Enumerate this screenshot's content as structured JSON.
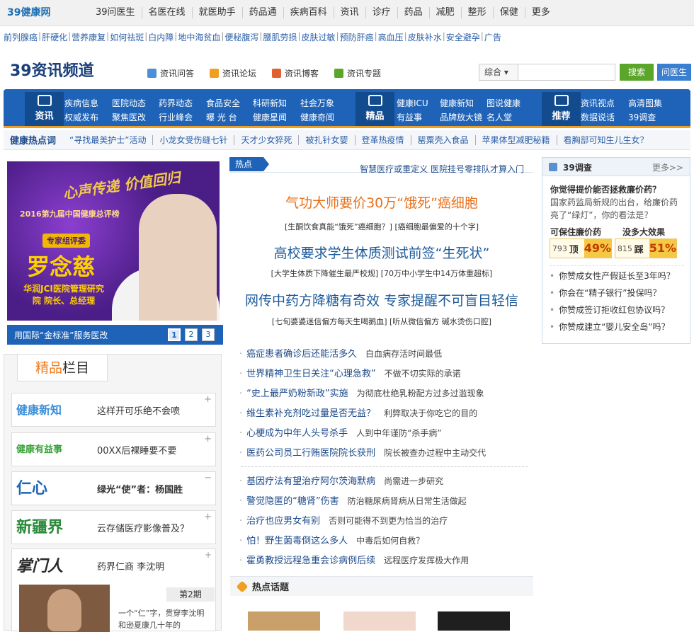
{
  "top": {
    "logo": "39健康网",
    "nav": [
      "39问医生",
      "名医在线",
      "就医助手",
      "药品通",
      "疾病百科",
      "资讯",
      "诊疗",
      "药品",
      "减肥",
      "整形",
      "保健",
      "更多"
    ]
  },
  "quick_links": [
    "前列腺癌",
    "肝硬化",
    "营养康复",
    "如何祛斑",
    "白内障",
    "地中海贫血",
    "便秘腹泻",
    "腰肌劳损",
    "皮肤过敏",
    "预防肝癌",
    "高血压",
    "皮肤补水",
    "安全避孕",
    "广告"
  ],
  "channel": {
    "logo": "39资讯频道",
    "links": [
      "资讯问答",
      "资讯论坛",
      "资讯博客",
      "资讯专题"
    ],
    "search_select": "综合",
    "search_btn": "搜索",
    "ask_btn": "问医生"
  },
  "bluenav": {
    "groups": [
      {
        "icon_label": "资讯",
        "cols": [
          [
            "疾病信息",
            "权威发布"
          ],
          [
            "医院动态",
            "聚焦医改"
          ],
          [
            "药界动态",
            "行业峰会"
          ],
          [
            "食品安全",
            "曝 光 台"
          ],
          [
            "科研新知",
            "健康星闻"
          ],
          [
            "社会万象",
            "健康奇闻"
          ]
        ]
      },
      {
        "icon_label": "精品",
        "cols": [
          [
            "健康ICU",
            "有益事"
          ],
          [
            "健康新知",
            "品牌放大镜"
          ],
          [
            "图说健康",
            "名人堂"
          ]
        ]
      },
      {
        "icon_label": "推荐",
        "cols": [
          [
            "资讯视点",
            "数据说话"
          ],
          [
            "高清图集",
            "39调查"
          ]
        ]
      }
    ]
  },
  "hotbar": {
    "title": "健康热点词",
    "items": [
      "“寻找最美护士”活动",
      "小龙女受伤缝七针",
      "天才少女猝死",
      "被扎针女婴",
      "登革热疫情",
      "罂粟壳入食品",
      "苹果体型减肥秘籍",
      "看胸部可知生儿生女？"
    ]
  },
  "banner": {
    "slogan": "心声传递 价值回归",
    "award": "2016第九届中国健康总评榜",
    "tag": "专家组评委",
    "name": "罗念慈",
    "org": "华润JCI医院管理研究院 院长、总经理",
    "caption": "用国际“金标准”服务医改",
    "pages": [
      "1",
      "2",
      "3"
    ]
  },
  "jingpin": {
    "title_a": "精品",
    "title_b": "栏目",
    "cards": [
      {
        "logo": "健康新知",
        "text": "这样开可乐绝不会喷",
        "sign": "+"
      },
      {
        "logo": "健康有益事",
        "text": "00XX后裸睡要不要",
        "sign": "+"
      },
      {
        "logo": "仁心",
        "text": "绿光“使”者：杨国胜",
        "sign": "−"
      },
      {
        "logo": "新疆界",
        "text": "云存储医疗影像普及？",
        "sign": "+"
      }
    ],
    "zmr": {
      "logo": "掌门人",
      "text": "药界仁商  李沈明",
      "issue": "第2期",
      "desc": "一个“仁”字，贯穿李沈明和逊夏康几十年的",
      "sign": "+"
    }
  },
  "middle": {
    "hot_tag": "热点",
    "top_right": "智慧医疗或重定义 医院挂号零排队才算入门",
    "headlines": [
      {
        "title": "气功大师要价30万“饿死”癌细胞",
        "sub": "[生酮饮食真能“饿死”癌细胞？] [癌细胞最偏爱的十个字]"
      },
      {
        "title": "高校要求学生体质测试前签“生死状”",
        "sub": "[大学生体质下降催生最严校规] [70万中小学生中14万体重超标]"
      },
      {
        "title": "网传中药方降糖有奇效 专家提醒不可盲目轻信",
        "sub": "[七旬婆婆迷信偏方每天生喝鹅血] [听从微信偏方 碱水烫伤口腔]"
      }
    ],
    "news1": [
      {
        "t": "癌症患者确诊后还能活多久",
        "s": "白血病存活时间最低"
      },
      {
        "t": "世界精神卫生日关注“心理急救”",
        "s": "不做不切实际的承诺"
      },
      {
        "t": "“史上最严奶粉新政”实施",
        "s": "为彻底杜绝乳粉配方过多过滥现象"
      },
      {
        "t": "维生素补充剂吃过量是否无益？",
        "s": "利弊取决于你吃它的目的"
      },
      {
        "t": "心梗成为中年人头号杀手",
        "s": "人到中年谨防“杀手病”"
      },
      {
        "t": "医药公司员工行贿医院院长获刑",
        "s": "院长被查办过程中主动交代"
      }
    ],
    "news2": [
      {
        "t": "基因疗法有望治疗阿尔茨海默病",
        "s": "尚需进一步研究"
      },
      {
        "t": "警觉隐匿的“糖肾”伤害",
        "s": "防治糖尿病肾病从日常生活做起"
      },
      {
        "t": "治疗也应男女有别",
        "s": "否则可能得不到更为恰当的治疗"
      },
      {
        "t": "怕！野生菌毒倒这么多人",
        "s": "中毒后如何自救？"
      },
      {
        "t": "霍勇教授远程急重会诊病例后续",
        "s": "远程医疗发挥极大作用"
      }
    ],
    "topic_title": "热点话题"
  },
  "survey": {
    "title": "39调查",
    "more": "更多>>",
    "question": "你觉得提价能否拯救廉价药？",
    "desc": "国家药监局新规的出台，给廉价药亮了“绿灯”，你的看法是？",
    "opt1": {
      "label": "可保住廉价药",
      "count": "793",
      "vote": "顶",
      "pct": "49%"
    },
    "opt2": {
      "label": "没多大效果",
      "count": "815",
      "vote": "踩",
      "pct": "51%"
    },
    "questions": [
      "你赞成女性产假延长至3年吗？",
      "你会在“精子银行”投保吗？",
      "你赞成签订拒收红包协议吗？",
      "你赞成建立“婴儿安全岛”吗？"
    ]
  },
  "colors": {
    "brand_blue": "#1e63b8",
    "orange": "#e8701a",
    "green": "#5aa52a"
  }
}
